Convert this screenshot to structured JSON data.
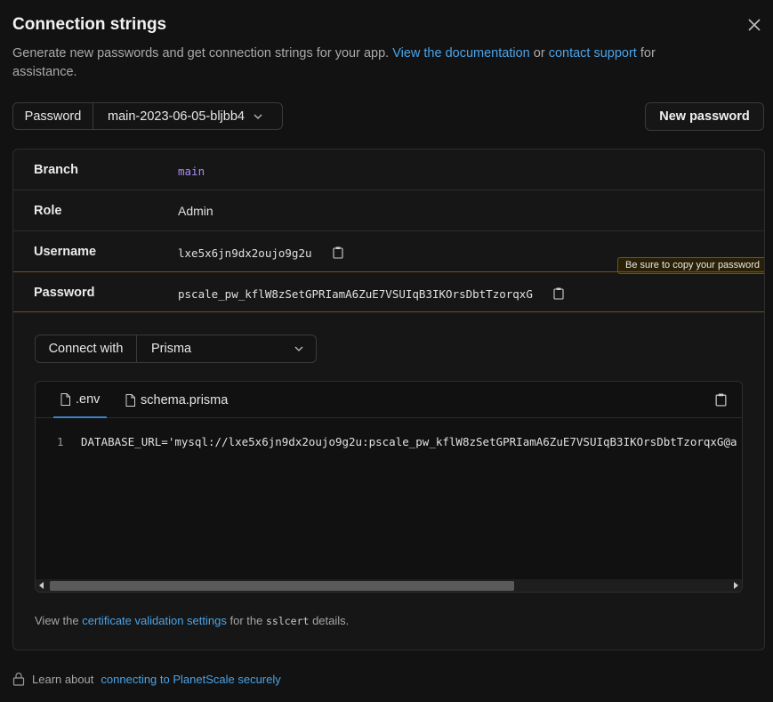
{
  "dialog": {
    "title": "Connection strings",
    "description_prefix": "Generate new passwords and get connection strings for your app.",
    "doc_link": "View the documentation",
    "or_text": "or",
    "support_link": "contact support",
    "description_suffix": "for assistance."
  },
  "password_select": {
    "label": "Password",
    "value": "main-2023-06-05-bljbb4"
  },
  "new_password_button": "New password",
  "details": [
    {
      "key": "Branch",
      "value": "main"
    },
    {
      "key": "Role",
      "value": "Admin"
    },
    {
      "key": "Username",
      "value": "lxe5x6jn9dx2oujo9g2u"
    },
    {
      "key": "Password",
      "value": "pscale_pw_kflW8zSetGPRIamA6ZuE7VSUIqB3IKOrsDbtTzorqxG"
    }
  ],
  "tooltip": "Be sure to copy your password",
  "connect_with": {
    "label": "Connect with",
    "value": "Prisma"
  },
  "code_tabs": [
    ".env",
    "schema.prisma"
  ],
  "code_lines": [
    {
      "number": "1",
      "text": "DATABASE_URL='mysql://lxe5x6jn9dx2oujo9g2u:pscale_pw_kflW8zSetGPRIamA6ZuE7VSUIqB3IKOrsDbtTzorqxG@a"
    }
  ],
  "cert_note": {
    "prefix": "View the",
    "link": "certificate validation settings",
    "middle": "for the",
    "code": "sslcert",
    "suffix": "details."
  },
  "learn": {
    "prefix": "Learn about",
    "link": "connecting to PlanetScale securely"
  },
  "colors": {
    "background": "#121212",
    "link": "#4aa3e8",
    "branch_value": "#a78bfa",
    "warning_border": "#6b5417",
    "tab_underline": "#3b82c4"
  }
}
